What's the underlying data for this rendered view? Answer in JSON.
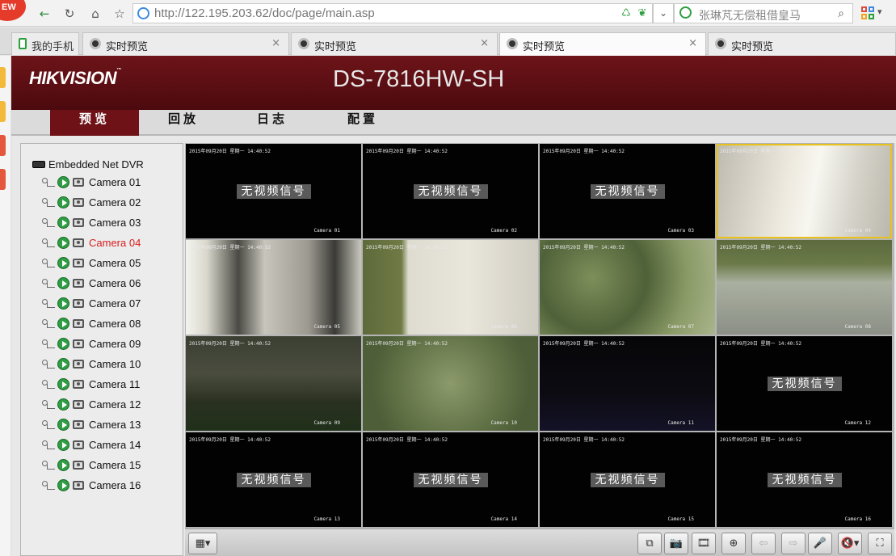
{
  "browser": {
    "new_badge": "EW",
    "url": "http://122.195.203.62/doc/page/main.asp",
    "search_text": "张琳芃无偿租借皇马",
    "tabs": [
      {
        "label": "我的手机",
        "icon": "phone-icon"
      },
      {
        "label": "实时预览",
        "icon": "globe-icon"
      },
      {
        "label": "实时预览",
        "icon": "globe-icon"
      },
      {
        "label": "实时预览",
        "icon": "globe-icon",
        "active": true
      },
      {
        "label": "实时预览",
        "icon": "globe-icon"
      }
    ],
    "tab_close": "×"
  },
  "header": {
    "logo": "HIKVISION",
    "logo_tm": "™",
    "model": "DS-7816HW-SH"
  },
  "menu": {
    "items": [
      {
        "label": "预览",
        "active": true
      },
      {
        "label": "回放"
      },
      {
        "label": "日志"
      },
      {
        "label": "配置"
      }
    ]
  },
  "tree": {
    "root_label": "Embedded Net DVR",
    "selected": "Camera 04",
    "cameras": [
      "Camera 01",
      "Camera 02",
      "Camera 03",
      "Camera 04",
      "Camera 05",
      "Camera 06",
      "Camera 07",
      "Camera 08",
      "Camera 09",
      "Camera 10",
      "Camera 11",
      "Camera 12",
      "Camera 13",
      "Camera 14",
      "Camera 15",
      "Camera 16"
    ]
  },
  "grid": {
    "no_signal_text": "无视频信号",
    "timestamp": "2015年09月20日 星期一 14:40:52",
    "cells": [
      {
        "cam_label": "Camera 01",
        "no_signal": true
      },
      {
        "cam_label": "Camera 02",
        "no_signal": true
      },
      {
        "cam_label": "Camera 03",
        "no_signal": true
      },
      {
        "cam_label": "Camera 04",
        "no_signal": false,
        "scene": "sc-corridor-bright",
        "selected": true
      },
      {
        "cam_label": "Camera 05",
        "no_signal": false,
        "scene": "sc-corridor-dark"
      },
      {
        "cam_label": "Camera 06",
        "no_signal": false,
        "scene": "sc-wall-green"
      },
      {
        "cam_label": "Camera 07",
        "no_signal": false,
        "scene": "sc-forest"
      },
      {
        "cam_label": "Camera 08",
        "no_signal": false,
        "scene": "sc-yard"
      },
      {
        "cam_label": "Camera 09",
        "no_signal": false,
        "scene": "sc-dark-grass"
      },
      {
        "cam_label": "Camera 10",
        "no_signal": false,
        "scene": "sc-bush"
      },
      {
        "cam_label": "Camera 11",
        "no_signal": false,
        "scene": "sc-night"
      },
      {
        "cam_label": "Camera 12",
        "no_signal": true
      },
      {
        "cam_label": "Camera 13",
        "no_signal": true
      },
      {
        "cam_label": "Camera 14",
        "no_signal": true
      },
      {
        "cam_label": "Camera 15",
        "no_signal": true
      },
      {
        "cam_label": "Camera 16",
        "no_signal": true
      }
    ]
  },
  "toolbar": {
    "layout_icon": "▦▾",
    "buttons": [
      {
        "name": "stop-all-button",
        "glyph": "⧉"
      },
      {
        "name": "capture-button",
        "glyph": "📷"
      },
      {
        "name": "record-button",
        "glyph": "🎞"
      },
      {
        "name": "zoom-button",
        "glyph": "⊕"
      },
      {
        "name": "prev-page-button",
        "glyph": "⇦"
      },
      {
        "name": "next-page-button",
        "glyph": "⇨"
      },
      {
        "name": "mic-button",
        "glyph": "🎤"
      },
      {
        "name": "volume-button",
        "glyph": "🔇▾"
      },
      {
        "name": "fullscreen-button",
        "glyph": "⛶"
      }
    ]
  }
}
